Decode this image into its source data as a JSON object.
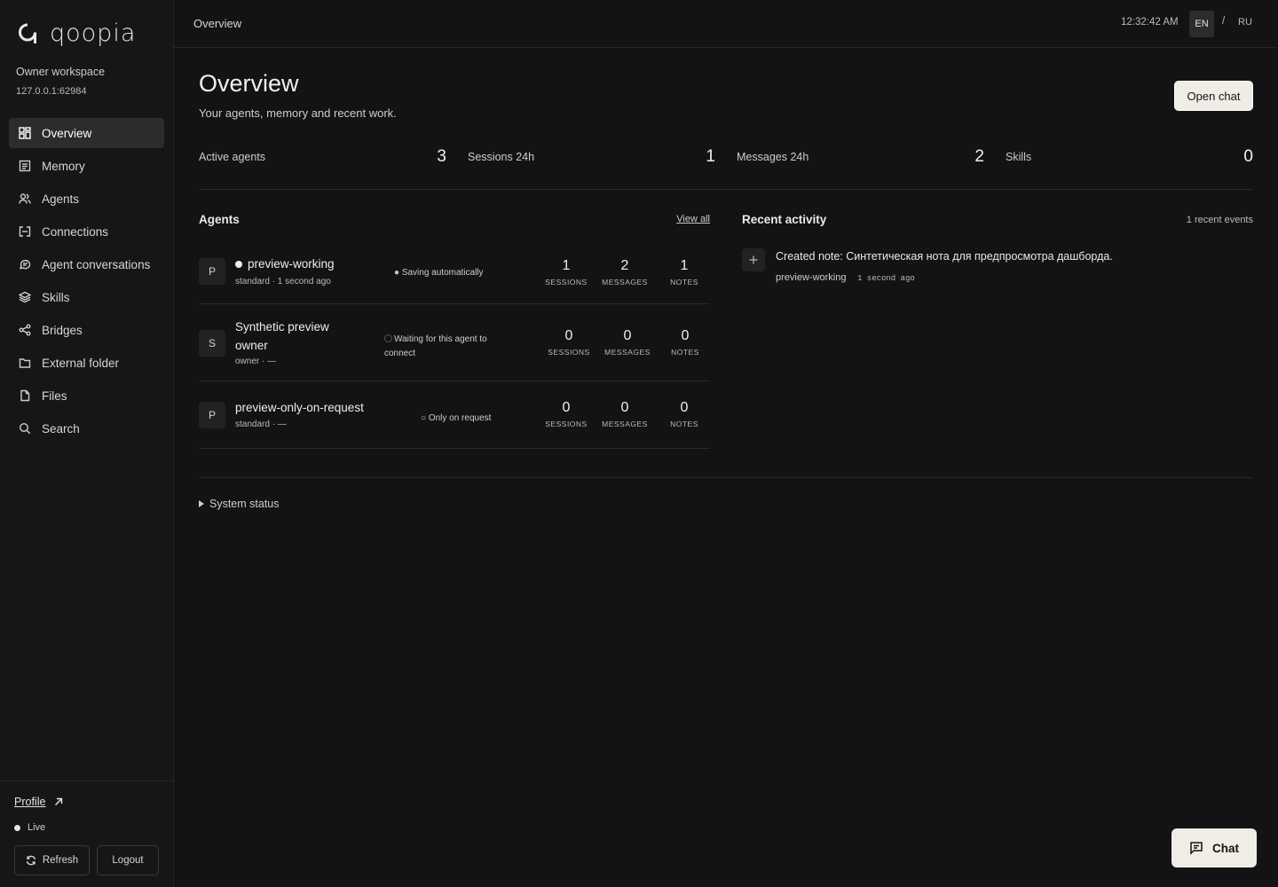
{
  "brand": {
    "name": "qoopia"
  },
  "workspace": {
    "name": "Owner workspace",
    "address": "127.0.0.1:62984"
  },
  "sidebar": {
    "items": [
      {
        "label": "Overview",
        "icon": "grid-icon",
        "active": true
      },
      {
        "label": "Memory",
        "icon": "memory-icon"
      },
      {
        "label": "Agents",
        "icon": "users-icon"
      },
      {
        "label": "Connections",
        "icon": "connections-icon"
      },
      {
        "label": "Agent conversations",
        "icon": "conversations-icon"
      },
      {
        "label": "Skills",
        "icon": "layers-icon"
      },
      {
        "label": "Bridges",
        "icon": "share-icon"
      },
      {
        "label": "External folder",
        "icon": "folder-icon"
      },
      {
        "label": "Files",
        "icon": "file-icon"
      },
      {
        "label": "Search",
        "icon": "search-icon"
      }
    ],
    "footer": {
      "profile": "Profile",
      "status": "Live",
      "refresh": "Refresh",
      "logout": "Logout"
    }
  },
  "topbar": {
    "breadcrumb": "Overview",
    "time": "12:32:42 AM",
    "lang_en": "EN",
    "lang_sep": "/",
    "lang_ru": "RU"
  },
  "page": {
    "title": "Overview",
    "subtitle": "Your agents, memory and recent work.",
    "open_chat": "Open chat"
  },
  "stats": [
    {
      "label": "Active agents",
      "value": "3"
    },
    {
      "label": "Sessions 24h",
      "value": "1"
    },
    {
      "label": "Messages 24h",
      "value": "2"
    },
    {
      "label": "Skills",
      "value": "0"
    }
  ],
  "agents": {
    "title": "Agents",
    "view_all": "View all",
    "metric_labels": {
      "sessions": "SESSIONS",
      "messages": "MESSAGES",
      "notes": "NOTES"
    },
    "rows": [
      {
        "initial": "P",
        "name": "preview-working",
        "meta": "standard · 1 second ago",
        "status": "● Saving automatically",
        "sessions": "1",
        "messages": "2",
        "notes": "1"
      },
      {
        "initial": "S",
        "name_line1": "Synthetic preview",
        "name_line2": "owner",
        "meta": "owner · —",
        "status_line1": "Waiting for this agent to",
        "status_line2": "connect",
        "sessions": "0",
        "messages": "0",
        "notes": "0"
      },
      {
        "initial": "P",
        "name": "preview-only-on-request",
        "meta": "standard · —",
        "status": "○ Only on request",
        "sessions": "0",
        "messages": "0",
        "notes": "0"
      }
    ]
  },
  "activity": {
    "title": "Recent activity",
    "count": "1 recent events",
    "events": [
      {
        "text": "Created note: Синтетическая нота для предпросмотра дашборда.",
        "agent": "preview-working",
        "time": "1 second ago"
      }
    ]
  },
  "system_status": "System status",
  "chat_fab": "Chat"
}
